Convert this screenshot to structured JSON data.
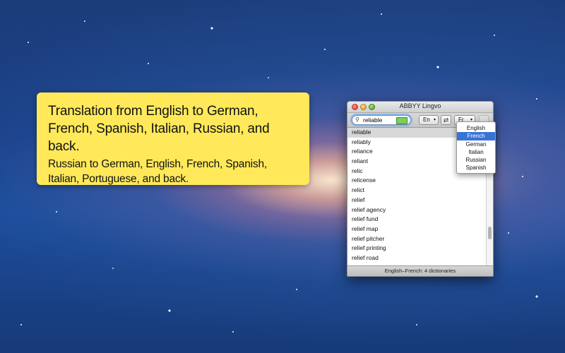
{
  "callout": {
    "line1": "Translation from English to German, French, Spanish, Italian, Russian, and back.",
    "line2": "Russian to German, English, French, Spanish, Italian, Portuguese, and back."
  },
  "window": {
    "title": "ABBYY Lingvo",
    "search_value": "reliable",
    "source_lang": "En",
    "target_lang": "Fr",
    "status": "English–French: 4 dictionaries",
    "words": [
      "reliable",
      "reliably",
      "reliance",
      "reliant",
      "relic",
      "relicense",
      "relict",
      "relief",
      "relief agency",
      "relief fund",
      "relief map",
      "relief pitcher",
      "relief printing",
      "relief road"
    ],
    "selected_index": 0
  },
  "dropdown": {
    "options": [
      "English",
      "French",
      "German",
      "Italian",
      "Russian",
      "Spanish"
    ],
    "selected": "French"
  },
  "icons": [
    "close-icon",
    "minimize-icon",
    "zoom-icon",
    "search-icon",
    "keyboard-icon",
    "swap-icon",
    "dictionary-icon"
  ]
}
